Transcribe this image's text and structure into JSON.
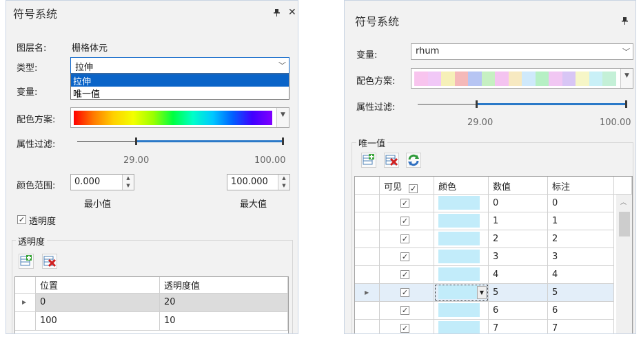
{
  "left": {
    "title": "符号系统",
    "pin": "📌",
    "close": "✕",
    "layer_label": "图层名:",
    "layer_value": "栅格体元",
    "type_label": "类型:",
    "type_value": "拉伸",
    "type_options": [
      "拉伸",
      "唯一值"
    ],
    "variable_label": "变量:",
    "color_scheme_label": "配色方案:",
    "filter_label": "属性过滤:",
    "filter_min": "29.00",
    "filter_max": "100.00",
    "filter_range": [
      29.0,
      100.0
    ],
    "color_range_label": "颜色范围:",
    "range_min_value": "0.000",
    "range_max_value": "100.000",
    "min_label": "最小值",
    "max_label": "最大值",
    "transparency_checkbox": "透明度",
    "transparency_group": "透明度",
    "grid_headers": [
      "位置",
      "透明度值"
    ],
    "grid_rows": [
      {
        "pos": "0",
        "value": "20"
      },
      {
        "pos": "100",
        "value": "10"
      }
    ]
  },
  "right": {
    "title": "符号系统",
    "pin": "📌",
    "variable_label": "变量:",
    "variable_value": "rhum",
    "color_scheme_label": "配色方案:",
    "scheme_colors": [
      "#f8c4ee",
      "#f1c8f7",
      "#f6f0b8",
      "#f5b9b9",
      "#b7c5f3",
      "#c6f0c2",
      "#f4c3f0",
      "#f7e9c1",
      "#cfe9fb",
      "#b6f0c4",
      "#f1c7f3",
      "#d8c6f5",
      "#f6f6c7",
      "#c9f0f7",
      "#c4f0d7"
    ],
    "filter_label": "属性过滤:",
    "filter_min": "29.00",
    "filter_max": "100.00",
    "filter_range": [
      29.0,
      100.0
    ],
    "unique_group": "唯一值",
    "grid_headers": {
      "visible": "可见",
      "color": "颜色",
      "value": "数值",
      "label": "标注"
    },
    "grid_rows": [
      {
        "value": "0",
        "label": "0"
      },
      {
        "value": "1",
        "label": "1"
      },
      {
        "value": "2",
        "label": "2"
      },
      {
        "value": "3",
        "label": "3"
      },
      {
        "value": "4",
        "label": "4"
      },
      {
        "value": "5",
        "label": "5"
      },
      {
        "value": "6",
        "label": "6"
      },
      {
        "value": "7",
        "label": "7"
      }
    ],
    "swatch_color": "#c2ecfa"
  },
  "colors": {
    "accent": "#2b79c8",
    "selection": "#0a64c8"
  }
}
